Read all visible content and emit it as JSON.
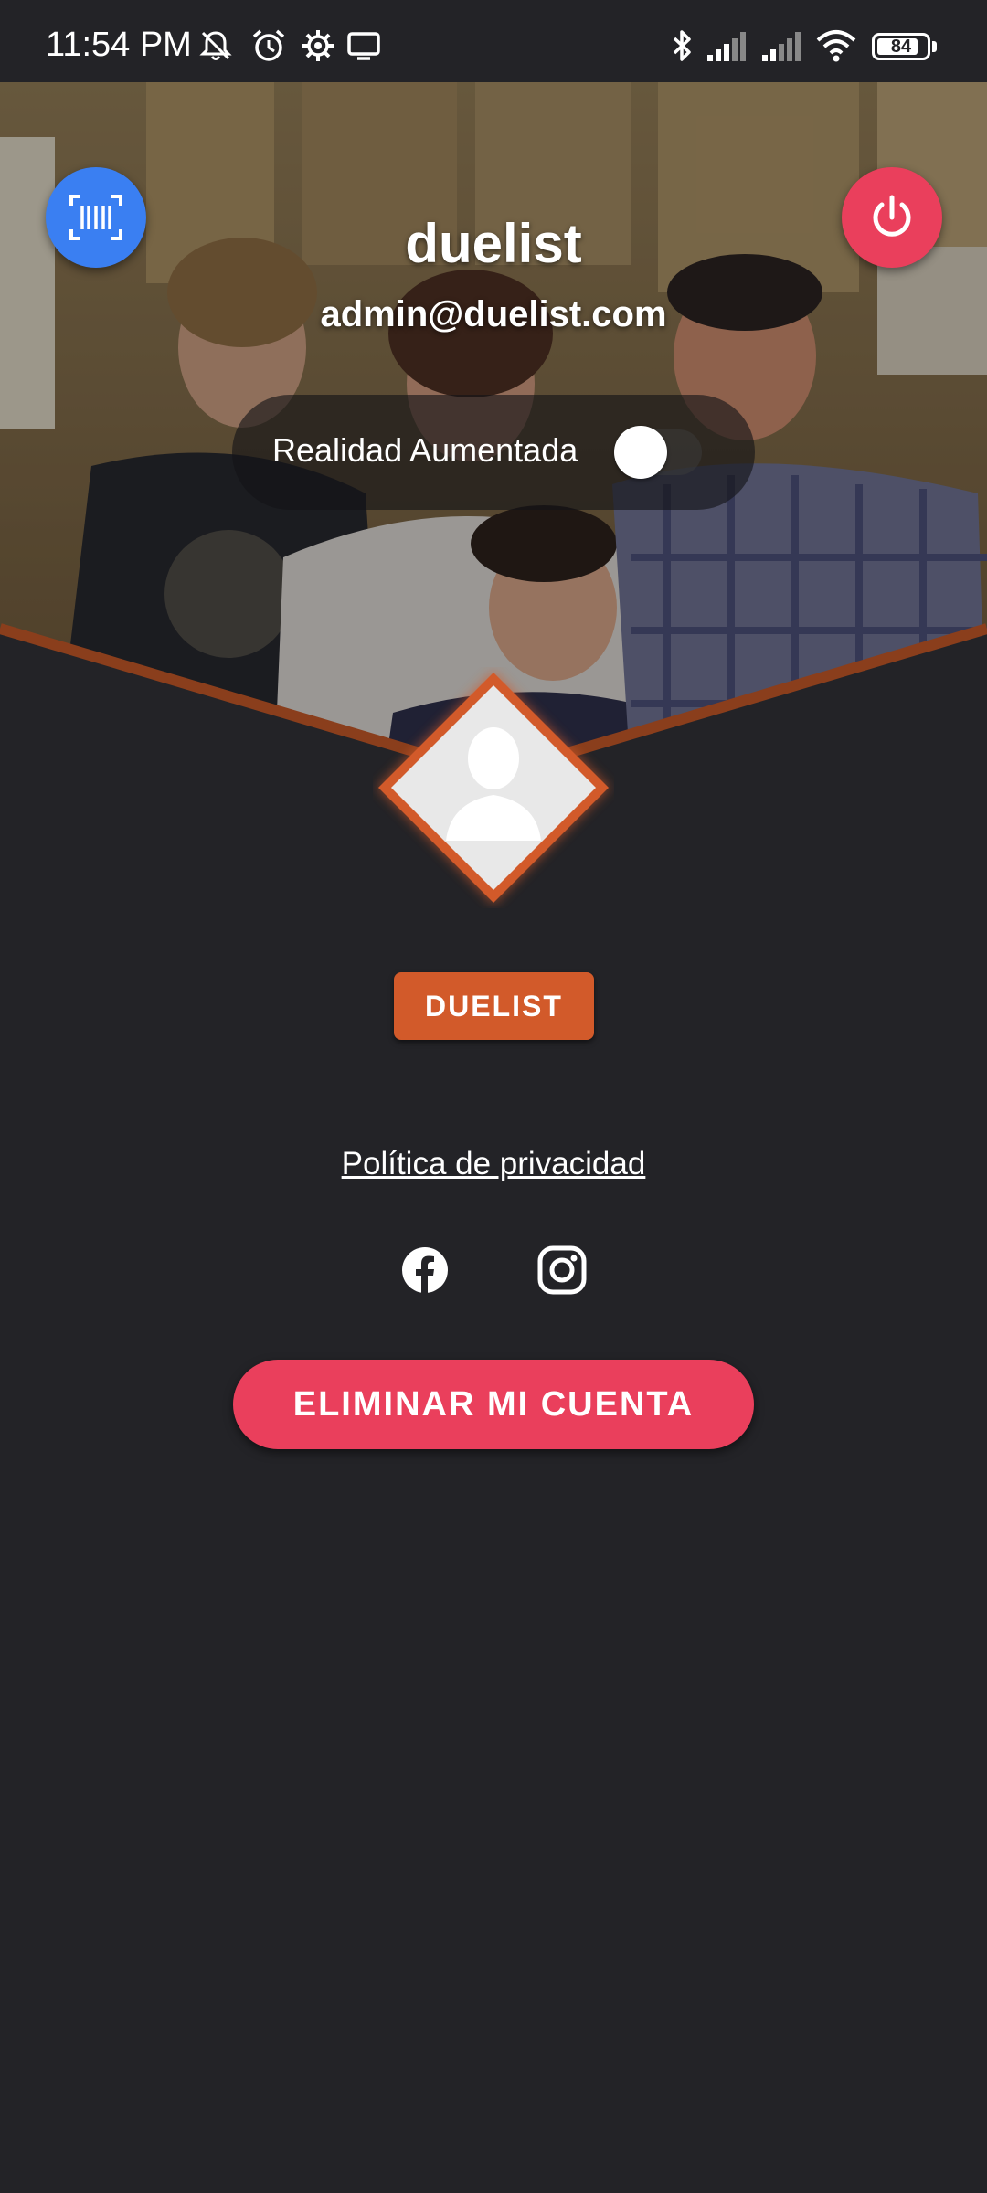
{
  "status_bar": {
    "time": "11:54 PM",
    "battery": "84",
    "battery_level": 0.84,
    "icons": [
      "mute-bell-icon",
      "alarm-icon",
      "settings-gear-icon",
      "cast-screen-icon",
      "bluetooth-icon",
      "signal-icon",
      "signal-icon",
      "wifi-icon",
      "battery-icon"
    ]
  },
  "profile": {
    "username": "duelist",
    "email": "admin@duelist.com",
    "role": "DUELIST"
  },
  "ar_toggle": {
    "label": "Realidad Aumentada",
    "enabled": false
  },
  "actions": {
    "scan_icon": "barcode-scan-icon",
    "logout_icon": "power-icon",
    "privacy_link": "Política de privacidad",
    "delete_account": "ELIMINAR MI CUENTA"
  },
  "social": [
    "facebook-icon",
    "instagram-icon"
  ],
  "colors": {
    "background": "#232327",
    "accent_orange": "#d25a2a",
    "danger_red": "#ea3f5c",
    "scan_blue": "#3a7ff2"
  }
}
